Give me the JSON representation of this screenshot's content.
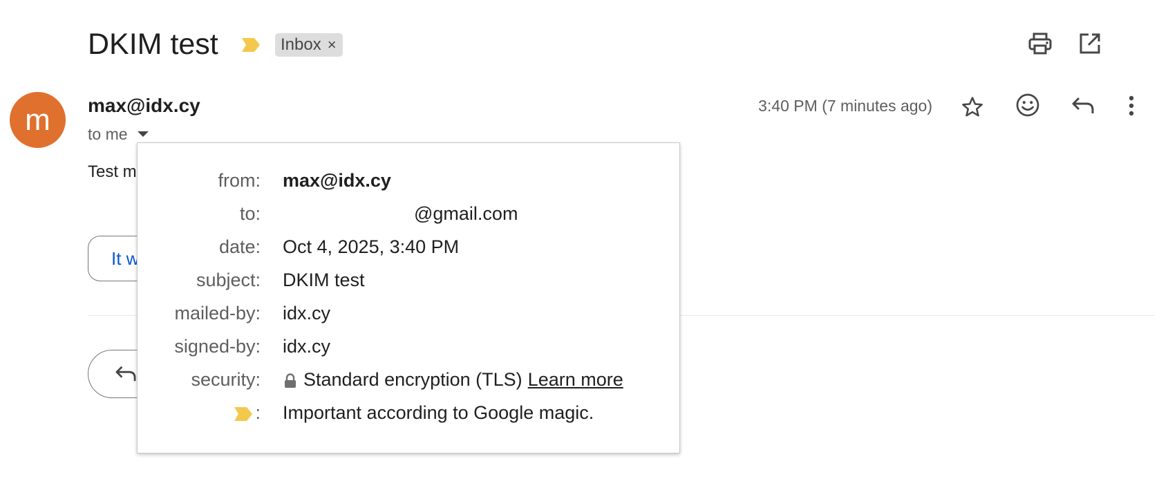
{
  "header": {
    "subject": "DKIM test",
    "label_chip": "Inbox",
    "label_remove": "×",
    "icons": [
      "print-icon",
      "open-in-new-window-icon"
    ]
  },
  "message": {
    "avatar_letter": "m",
    "avatar_color": "#e0702d",
    "sender": "max@idx.cy",
    "recipient_summary": "to me",
    "time": "3:40 PM (7 minutes ago)",
    "body_visible": "Test m",
    "smart_reply_visible": "It w",
    "actions": [
      "star-icon",
      "emoji-react-icon",
      "reply-icon",
      "more-vert-icon"
    ]
  },
  "details": {
    "rows": [
      {
        "label": "from:",
        "value": "max@idx.cy"
      },
      {
        "label": "to:",
        "value": "@gmail.com"
      },
      {
        "label": "date:",
        "value": "Oct 4, 2025, 3:40 PM"
      },
      {
        "label": "subject:",
        "value": "DKIM test"
      },
      {
        "label": "mailed-by:",
        "value": "idx.cy"
      },
      {
        "label": "signed-by:",
        "value": "idx.cy"
      },
      {
        "label": "security:",
        "value": "Standard encryption (TLS)",
        "link": "Learn more"
      },
      {
        "label": ":",
        "value": "Important according to Google magic."
      }
    ]
  },
  "colors": {
    "importance_marker": "#f2c94c",
    "link_blue": "#0b57d0",
    "chip_bg": "#dddddd"
  }
}
